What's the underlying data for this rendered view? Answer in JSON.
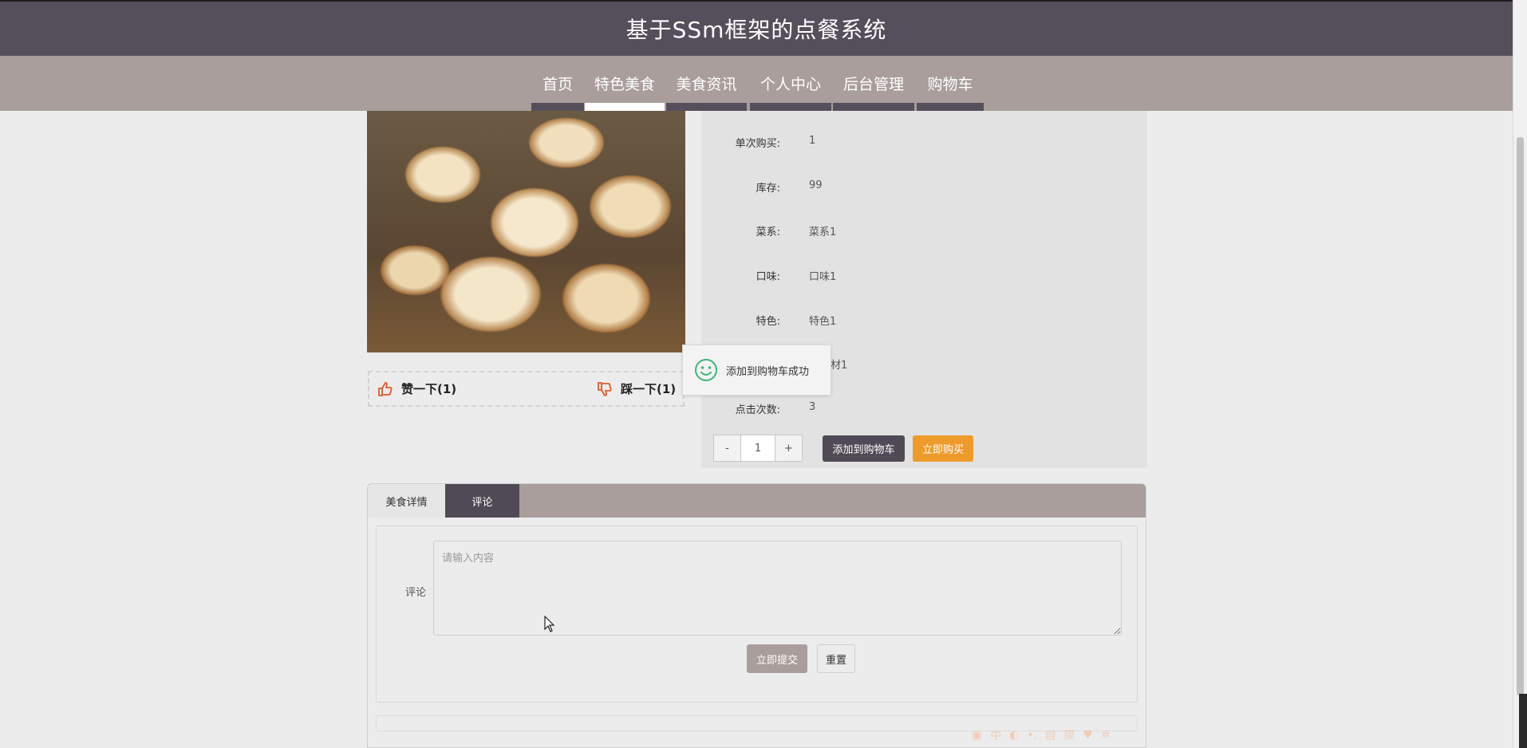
{
  "site": {
    "title": "基于SSm框架的点餐系统"
  },
  "nav": {
    "items": [
      {
        "label": "首页",
        "active": false
      },
      {
        "label": "特色美食",
        "active": true
      },
      {
        "label": "美食资讯",
        "active": false
      },
      {
        "label": "个人中心",
        "active": false
      },
      {
        "label": "后台管理",
        "active": false
      },
      {
        "label": "购物车",
        "active": false
      }
    ]
  },
  "food": {
    "image_alt": "food-photo",
    "votes": {
      "like_label": "赞一下(1)",
      "dislike_label": "踩一下(1)"
    },
    "info": [
      {
        "label": "单次购买:",
        "value": "1"
      },
      {
        "label": "库存:",
        "value": "99"
      },
      {
        "label": "菜系:",
        "value": "菜系1"
      },
      {
        "label": "口味:",
        "value": "口味1"
      },
      {
        "label": "特色:",
        "value": "特色1"
      },
      {
        "label": "",
        "value": "材1"
      },
      {
        "label": "点击次数:",
        "value": "3"
      }
    ],
    "quantity": {
      "minus": "-",
      "value": "1",
      "plus": "+"
    },
    "add_to_cart_label": "添加到购物车",
    "buy_now_label": "立即购买"
  },
  "toast": {
    "message": "添加到购物车成功",
    "icon": "smile-icon"
  },
  "tabs": [
    {
      "label": "美食详情",
      "active": false
    },
    {
      "label": "评论",
      "active": true
    }
  ],
  "comment": {
    "label": "评论",
    "placeholder": "请输入内容",
    "submit_label": "立即提交",
    "reset_label": "重置"
  },
  "ime": {
    "glyphs": [
      "中",
      "简"
    ]
  },
  "colors": {
    "header_bg": "#544f5b",
    "nav_bg": "#a99e9b",
    "accent_orange": "#ee9b2c",
    "dark_button": "#4f4a55"
  }
}
